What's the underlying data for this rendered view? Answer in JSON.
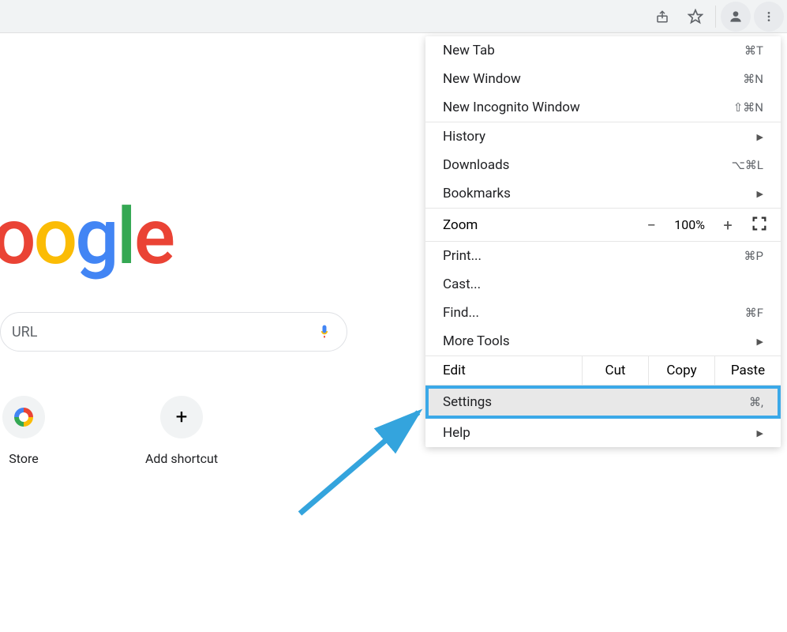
{
  "toolbar": {
    "icons": [
      "share",
      "bookmark-star",
      "profile",
      "more"
    ]
  },
  "logo_text": "oogle",
  "search": {
    "placeholder": "URL"
  },
  "shortcuts": [
    {
      "label": "Store",
      "icon": "webstore"
    },
    {
      "label": "Add shortcut",
      "icon": "plus"
    }
  ],
  "menu": {
    "section1": [
      {
        "label": "New Tab",
        "shortcut": "⌘T"
      },
      {
        "label": "New Window",
        "shortcut": "⌘N"
      },
      {
        "label": "New Incognito Window",
        "shortcut": "⇧⌘N"
      }
    ],
    "section2": [
      {
        "label": "History",
        "submenu": true
      },
      {
        "label": "Downloads",
        "shortcut": "⌥⌘L"
      },
      {
        "label": "Bookmarks",
        "submenu": true
      }
    ],
    "zoom": {
      "label": "Zoom",
      "value": "100%"
    },
    "section3": [
      {
        "label": "Print...",
        "shortcut": "⌘P"
      },
      {
        "label": "Cast..."
      },
      {
        "label": "Find...",
        "shortcut": "⌘F"
      },
      {
        "label": "More Tools",
        "submenu": true
      }
    ],
    "edit": {
      "label": "Edit",
      "cut": "Cut",
      "copy": "Copy",
      "paste": "Paste"
    },
    "settings": {
      "label": "Settings",
      "shortcut": "⌘,"
    },
    "help": {
      "label": "Help",
      "submenu": true
    }
  }
}
